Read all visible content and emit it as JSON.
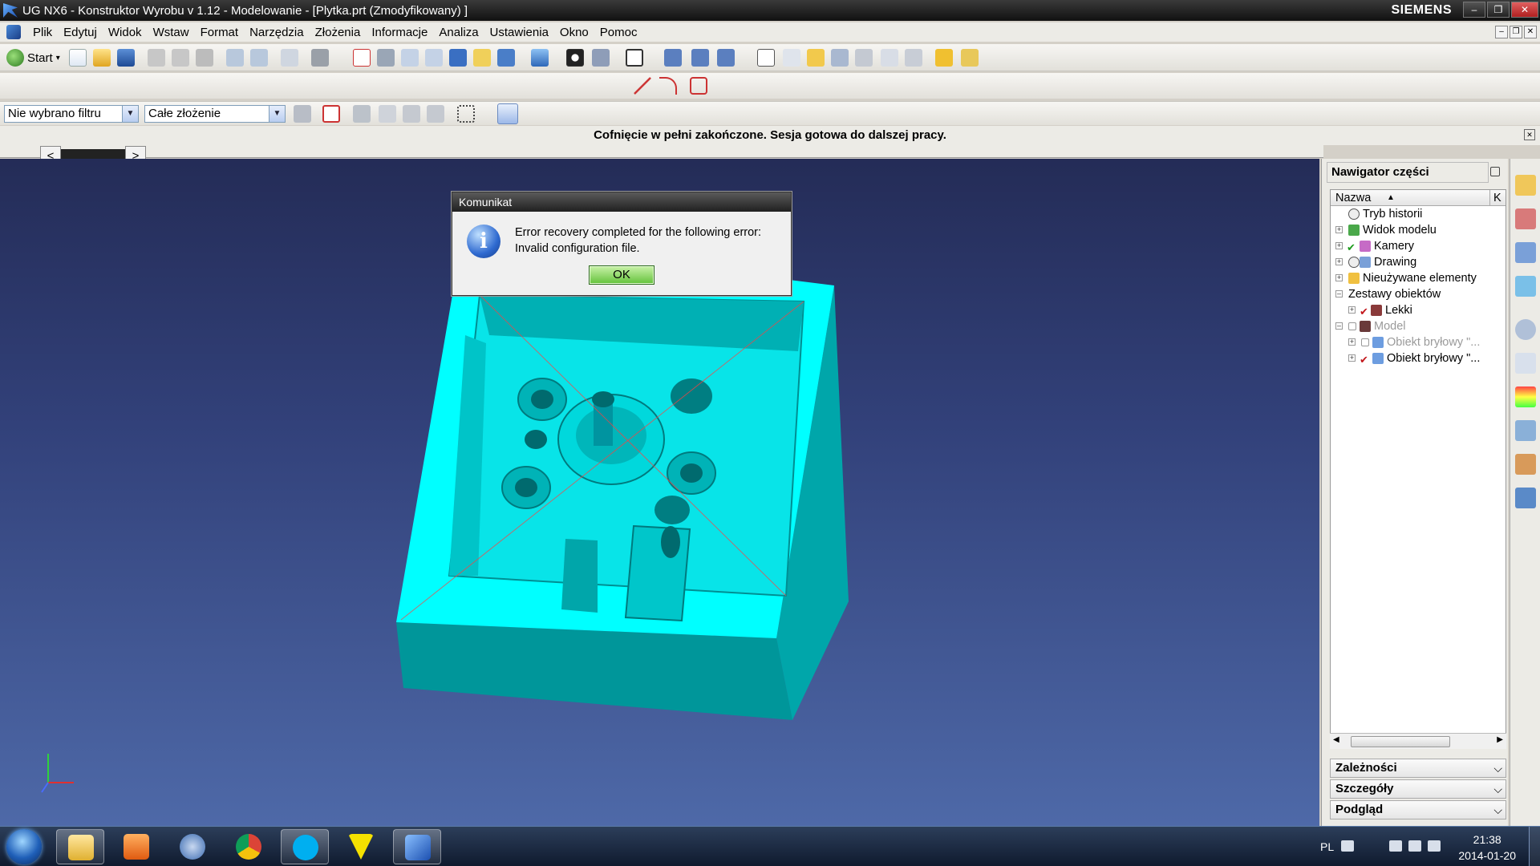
{
  "window": {
    "title": "UG NX6 - Konstruktor Wyrobu v 1.12 - Modelowanie - [Plytka.prt (Zmodyfikowany) ]",
    "brand": "SIEMENS",
    "min_glyph": "–",
    "restore_glyph": "❐",
    "close_glyph": "✕"
  },
  "menu": {
    "items": [
      "Plik",
      "Edytuj",
      "Widok",
      "Wstaw",
      "Format",
      "Narzędzia",
      "Złożenia",
      "Informacje",
      "Analiza",
      "Ustawienia",
      "Okno",
      "Pomoc"
    ]
  },
  "toolbar": {
    "start_label": "Start",
    "start_arrow": "▾"
  },
  "selection_bar": {
    "filter_value": "Nie wybrano filtru",
    "scope_value": "Całe złożenie",
    "arrow_glyph": "▼"
  },
  "status": {
    "message": "Cofnięcie w pełni zakończone. Sesja gotowa do dalszej pracy.",
    "close_glyph": "✕"
  },
  "tabs": {
    "left_arrow": "<",
    "right_arrow": ">"
  },
  "dialog": {
    "title": "Komunikat",
    "icon_glyph": "i",
    "line1": "Error recovery completed for the following error:",
    "line2": "Invalid configuration file.",
    "ok_label": "OK"
  },
  "navigator": {
    "title": "Nawigator części",
    "column_name": "Nazwa",
    "sort_glyph": "▲",
    "column_k": "K",
    "items": [
      {
        "label": "Tryb historii"
      },
      {
        "label": "Widok modelu"
      },
      {
        "label": "Kamery"
      },
      {
        "label": "Drawing"
      },
      {
        "label": "Nieużywane elementy"
      },
      {
        "label": "Zestawy obiektów"
      },
      {
        "label": "Lekki"
      },
      {
        "label": "Model"
      },
      {
        "label": "Obiekt bryłowy \"..."
      },
      {
        "label": "Obiekt bryłowy \"..."
      }
    ],
    "panels": [
      "Zależności",
      "Szczegóły",
      "Podgląd"
    ],
    "expand_plus": "+",
    "expand_minus": "–",
    "check_glyph": "✔",
    "chevron_glyph": "⌵",
    "scroll_left": "◀",
    "scroll_right": "▶"
  },
  "taskbar": {
    "language": "PL",
    "time": "21:38",
    "date": "2014-01-20"
  },
  "colors": {
    "model_cyan": "#00ffff",
    "viewport_top": "#242c57",
    "viewport_bottom": "#4e69a8",
    "ok_button": "#63c23b"
  }
}
